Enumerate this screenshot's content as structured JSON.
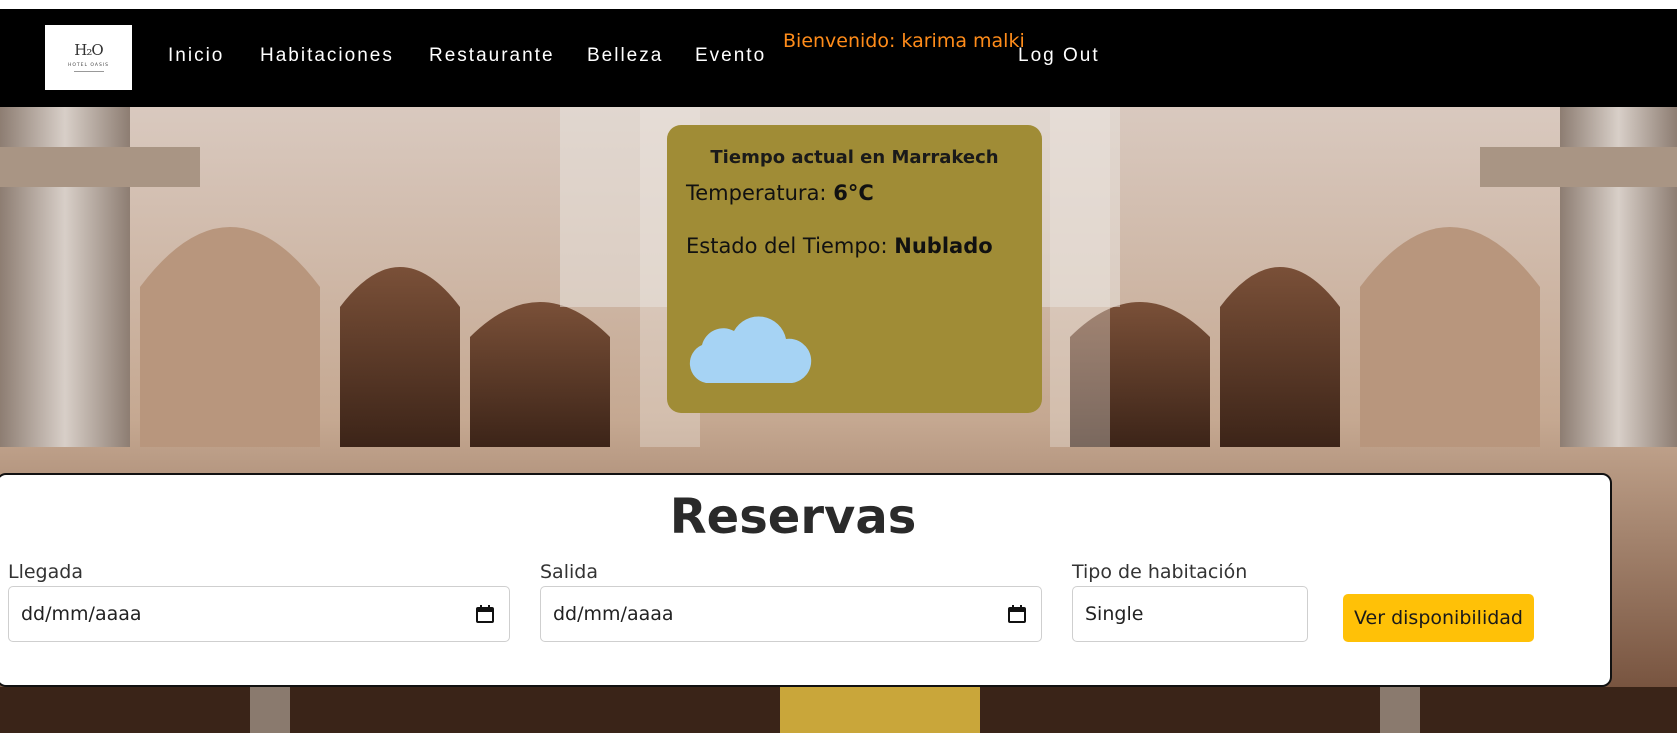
{
  "logo": {
    "mark": "H₂O",
    "name": "HOTEL OASIS"
  },
  "nav": {
    "items": [
      "Inicio",
      "Habitaciones",
      "Restaurante",
      "Belleza",
      "Evento"
    ],
    "welcome": "Bienvenido: karima malki",
    "logout": "Log Out"
  },
  "weather": {
    "title": "Tiempo actual en Marrakech",
    "temp_label": "Temperatura:",
    "temp_value": "6°C",
    "state_label": "Estado del Tiempo:",
    "state_value": "Nublado",
    "icon": "cloud-icon",
    "card_color": "#a08c36"
  },
  "reservas": {
    "title": "Reservas",
    "arrival": {
      "label": "Llegada",
      "value": "dd/mm/aaaa"
    },
    "departure": {
      "label": "Salida",
      "value": "dd/mm/aaaa"
    },
    "room_type": {
      "label": "Tipo de habitación",
      "value": "Single"
    },
    "button": "Ver disponibilidad"
  },
  "colors": {
    "accent": "#ffc107",
    "welcome": "#ff8c1a",
    "navbar": "#000000"
  }
}
